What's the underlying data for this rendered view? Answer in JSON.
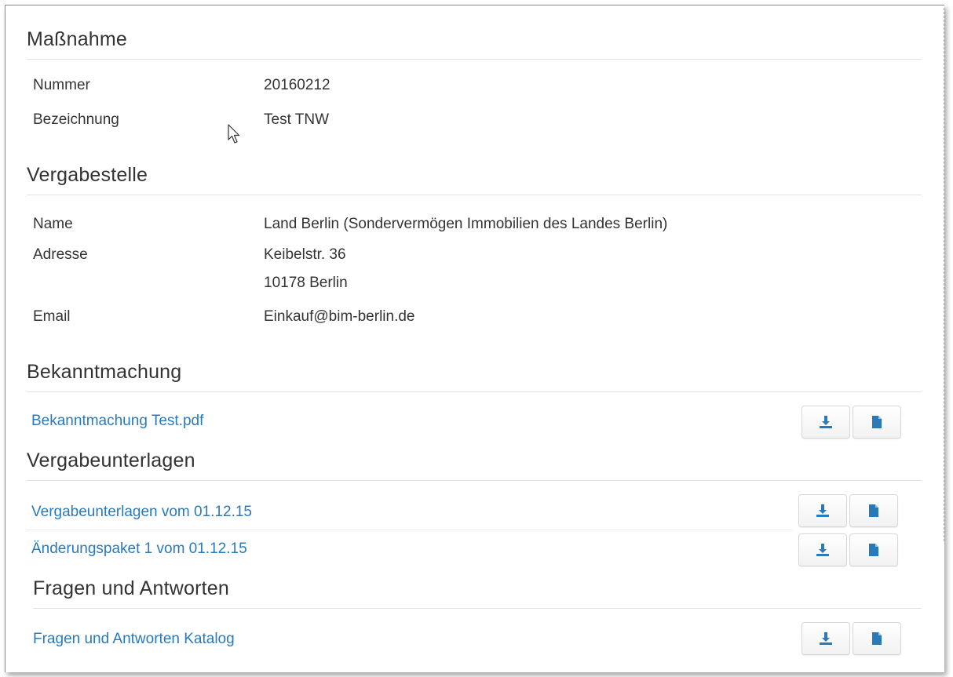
{
  "massnahme": {
    "title": "Maßnahme",
    "nummer_label": "Nummer",
    "nummer_value": "20160212",
    "bezeichnung_label": "Bezeichnung",
    "bezeichnung_value": "Test TNW"
  },
  "vergabestelle": {
    "title": "Vergabestelle",
    "name_label": "Name",
    "name_value": "Land Berlin (Sondervermögen Immobilien des Landes Berlin)",
    "adresse_label": "Adresse",
    "adresse_line1": "Keibelstr. 36",
    "adresse_line2": "10178 Berlin",
    "email_label": "Email",
    "email_value": "Einkauf@bim-berlin.de"
  },
  "bekanntmachung": {
    "title": "Bekanntmachung",
    "items": [
      {
        "label": "Bekanntmachung Test.pdf"
      }
    ]
  },
  "vergabeunterlagen": {
    "title": "Vergabeunterlagen",
    "items": [
      {
        "label": "Vergabeunterlagen vom 01.12.15"
      },
      {
        "label": "Änderungspaket 1 vom 01.12.15"
      }
    ]
  },
  "fragen": {
    "title": "Fragen und Antworten",
    "items": [
      {
        "label": "Fragen und Antworten Katalog"
      }
    ]
  },
  "icons": {
    "download": "download-icon",
    "document": "document-icon",
    "accent_color": "#2a7ab8"
  }
}
